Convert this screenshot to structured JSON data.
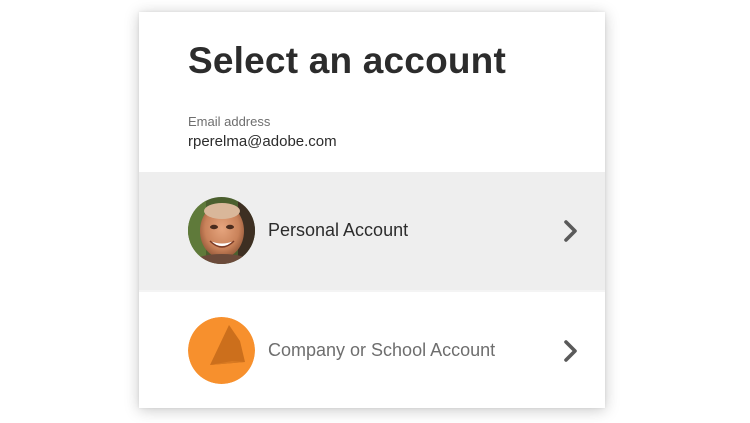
{
  "dialog": {
    "title": "Select an account",
    "email_label": "Email address",
    "email_value": "rperelma@adobe.com"
  },
  "accounts": [
    {
      "label": "Personal Account",
      "avatar": "profile-photo",
      "icon": "chevron-right-icon"
    },
    {
      "label": "Company or School Account",
      "avatar": "orange-company-logo",
      "icon": "chevron-right-icon"
    }
  ],
  "colors": {
    "selected_row_bg": "#eeeeee",
    "company_logo_orange": "#f7902d",
    "company_logo_shade": "#cc6f1c",
    "chevron": "#5a5a5a",
    "text_primary": "#2c2c2c",
    "text_secondary": "#6e6e6e"
  }
}
